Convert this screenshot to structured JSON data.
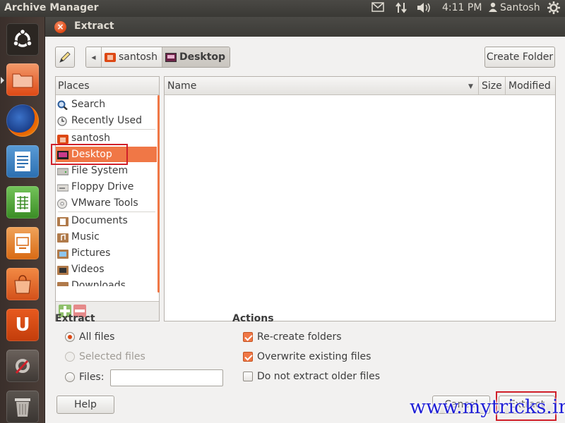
{
  "topbar": {
    "app_title": "Archive Manager",
    "time": "4:11 PM",
    "user": "Santosh"
  },
  "launcher": {
    "items": [
      "ubuntu-dash",
      "home-folder",
      "firefox",
      "libreoffice-writer",
      "libreoffice-calc",
      "libreoffice-impress",
      "ubuntu-software-center",
      "ubuntu-one",
      "system-settings",
      "trash"
    ]
  },
  "dialog": {
    "title": "Extract",
    "path": [
      "santosh",
      "Desktop"
    ],
    "create_folder_label": "Create Folder",
    "places": {
      "header": "Places",
      "items": [
        "Search",
        "Recently Used",
        "santosh",
        "Desktop",
        "File System",
        "Floppy Drive",
        "VMware Tools",
        "Documents",
        "Music",
        "Pictures",
        "Videos",
        "Downloads"
      ],
      "selected": "Desktop"
    },
    "file_columns": [
      "Name",
      "Size",
      "Modified"
    ],
    "extract_section": {
      "title": "Extract",
      "all_files": "All files",
      "selected_files": "Selected files",
      "files_label": "Files:",
      "files_value": ""
    },
    "actions_section": {
      "title": "Actions",
      "recreate_folders": "Re-create folders",
      "overwrite_existing": "Overwrite existing files",
      "do_not_extract_older": "Do not extract older files"
    },
    "help_label": "Help",
    "cancel_label": "Cancel",
    "extract_label": "Extract"
  },
  "watermark": "www.mytricks.in",
  "colors": {
    "accent": "#f07746",
    "ubuntu_orange": "#dd4814",
    "highlight_red": "#d0202a",
    "watermark_blue": "#1f1fd6"
  }
}
